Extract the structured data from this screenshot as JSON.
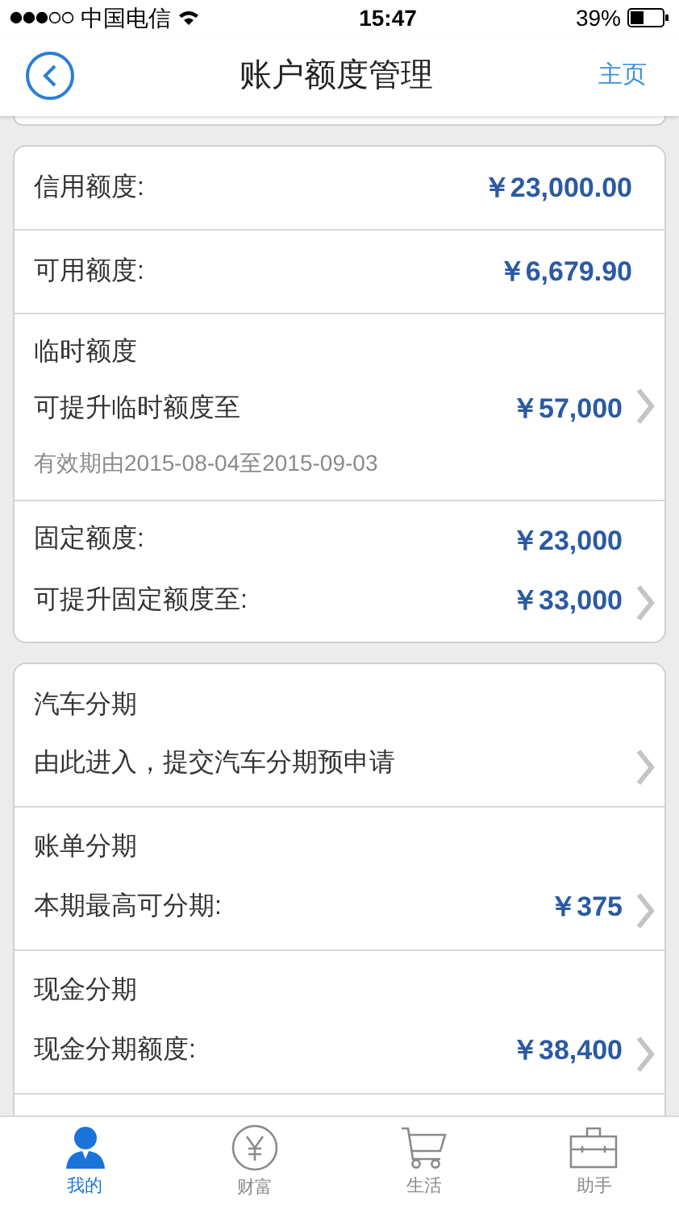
{
  "status_bar": {
    "carrier": "中国电信",
    "time": "15:47",
    "battery": "39%"
  },
  "nav": {
    "title": "账户额度管理",
    "home": "主页"
  },
  "limit_card": [
    {
      "kind": "simple",
      "label": "信用额度:",
      "value": "￥23,000.00"
    },
    {
      "kind": "simple",
      "label": "可用额度:",
      "value": "￥6,679.90"
    },
    {
      "kind": "temporary",
      "title": "临时额度",
      "label": "可提升临时额度至",
      "value": "￥57,000",
      "note": "有效期由2015-08-04至2015-09-03"
    },
    {
      "kind": "double",
      "lines": [
        {
          "label": "固定额度:",
          "value": "￥23,000"
        },
        {
          "label": "可提升固定额度至:",
          "value": "￥33,000"
        }
      ]
    }
  ],
  "installment_card": [
    {
      "title": "汽车分期",
      "label": "由此进入，提交汽车分期预申请"
    },
    {
      "title": "账单分期",
      "label": "本期最高可分期:",
      "value": "￥375"
    },
    {
      "title": "现金分期",
      "label": "现金分期额度:",
      "value": "￥38,400"
    }
  ],
  "tab_bar": [
    {
      "kind": "person",
      "label": "我的",
      "selected": true
    },
    {
      "kind": "yen",
      "label": "财富",
      "selected": false
    },
    {
      "kind": "cart",
      "label": "生活",
      "selected": false
    },
    {
      "kind": "briefcase",
      "label": "助手",
      "selected": false
    }
  ]
}
